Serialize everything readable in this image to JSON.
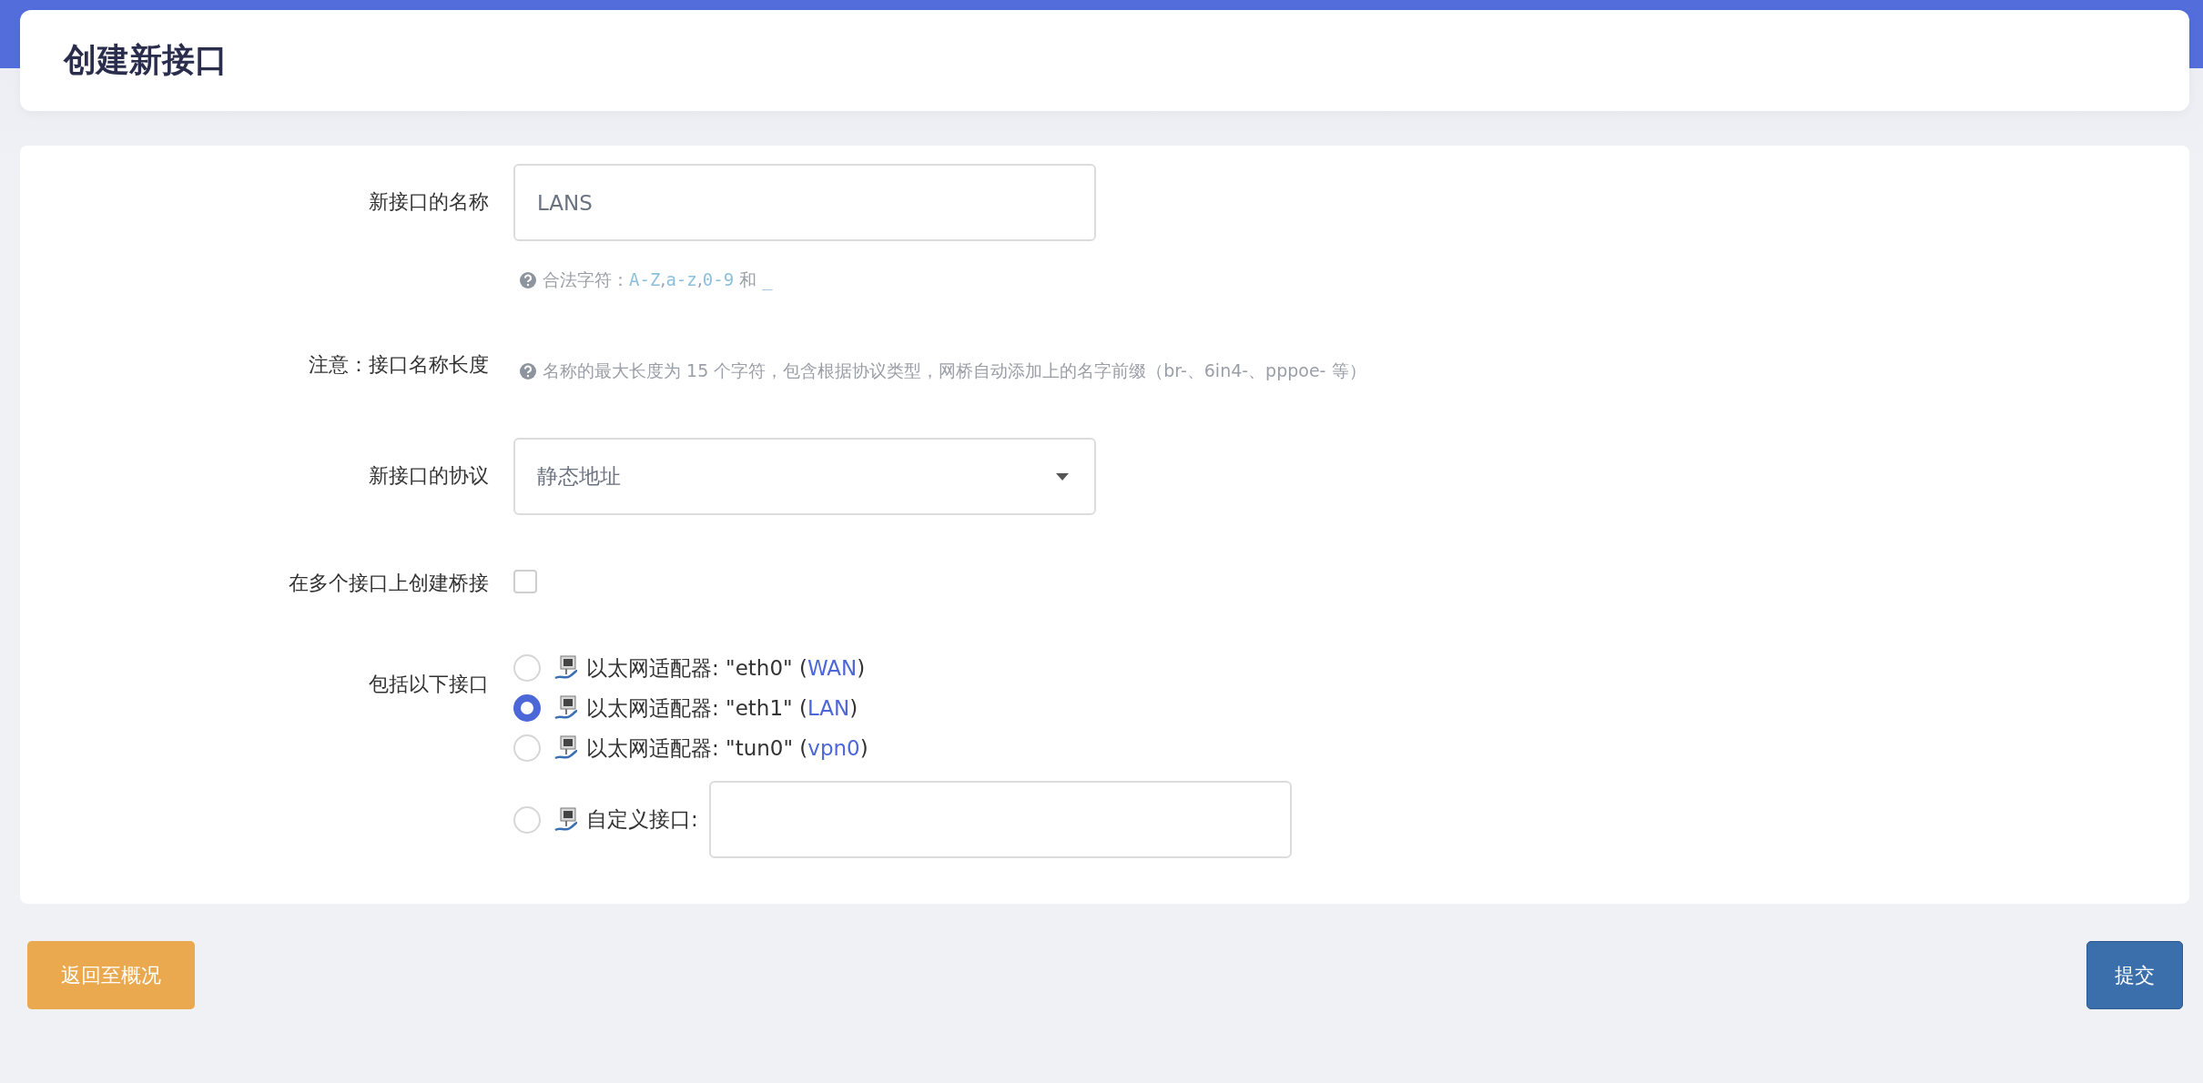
{
  "header": {
    "title": "创建新接口"
  },
  "form": {
    "rows": [
      {
        "kind": "text",
        "label": "新接口的名称",
        "value": "LANS",
        "hint": [
          {
            "kind": "text",
            "text": "合法字符："
          },
          {
            "kind": "code",
            "text": "A-Z"
          },
          {
            "kind": "text",
            "text": ","
          },
          {
            "kind": "code",
            "text": "a-z"
          },
          {
            "kind": "text",
            "text": ","
          },
          {
            "kind": "code",
            "text": "0-9"
          },
          {
            "kind": "text",
            "text": " 和 "
          },
          {
            "kind": "code",
            "text": "_"
          }
        ]
      },
      {
        "kind": "note",
        "label": "注意：接口名称长度",
        "hint": [
          {
            "kind": "text",
            "text": "名称的最大长度为 15 个字符，包含根据协议类型，网桥自动添加上的名字前缀（br-、6in4-、pppoe- 等）"
          }
        ]
      },
      {
        "kind": "select",
        "label": "新接口的协议",
        "value": "静态地址"
      },
      {
        "kind": "checkbox",
        "label": "在多个接口上创建桥接",
        "checked": false
      },
      {
        "kind": "radios",
        "label": "包括以下接口",
        "options": [
          {
            "kind": "adapter",
            "prefix": "以太网适配器: \"eth0\" (",
            "link": "WAN",
            "suffix": ")",
            "selected": false
          },
          {
            "kind": "adapter",
            "prefix": "以太网适配器: \"eth1\" (",
            "link": "LAN",
            "suffix": ")",
            "selected": true
          },
          {
            "kind": "adapter",
            "prefix": "以太网适配器: \"tun0\" (",
            "link": "vpn0",
            "suffix": ")",
            "selected": false
          },
          {
            "kind": "custom",
            "prefix": "自定义接口:",
            "selected": false
          }
        ]
      }
    ]
  },
  "buttons": [
    {
      "kind": "back",
      "label": "返回至概况"
    },
    {
      "kind": "submit",
      "label": "提交"
    }
  ]
}
